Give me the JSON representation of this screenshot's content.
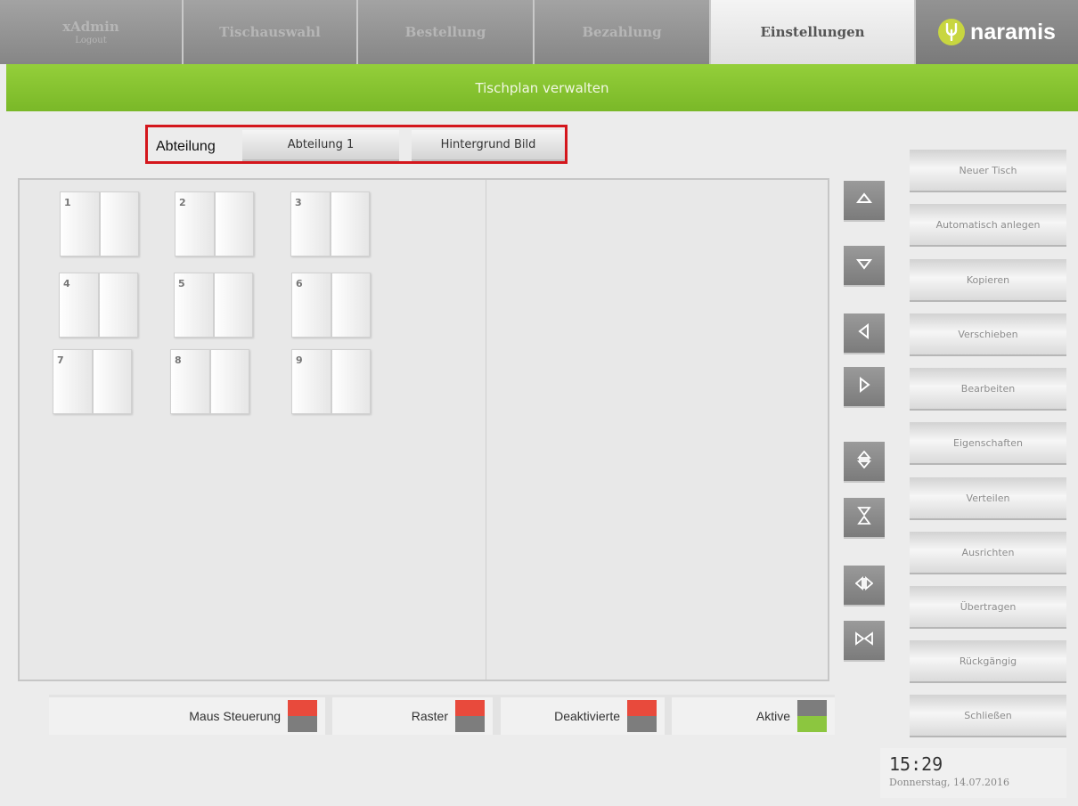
{
  "nav": {
    "tabs": [
      {
        "label": "xAdmin",
        "sub": "Logout"
      },
      {
        "label": "Tischauswahl"
      },
      {
        "label": "Bestellung"
      },
      {
        "label": "Bezahlung"
      },
      {
        "label": "Einstellungen",
        "active": true
      }
    ],
    "logo_text": "naramis"
  },
  "banner": {
    "title": "Tischplan verwalten"
  },
  "section": {
    "label": "Abteilung",
    "selected": "Abteilung 1",
    "background_button": "Hintergrund Bild"
  },
  "tables": [
    "1",
    "2",
    "3",
    "4",
    "5",
    "6",
    "7",
    "8",
    "9"
  ],
  "arrows": [
    {
      "icon": "triangle-up-icon"
    },
    {
      "icon": "triangle-down-icon"
    },
    {
      "icon": "triangle-left-icon"
    },
    {
      "icon": "triangle-right-icon"
    },
    {
      "icon": "expand-vertical-icon"
    },
    {
      "icon": "contract-vertical-icon"
    },
    {
      "icon": "expand-horizontal-icon"
    },
    {
      "icon": "contract-horizontal-icon"
    }
  ],
  "actions": [
    "Neuer Tisch",
    "Automatisch anlegen",
    "Kopieren",
    "Verschieben",
    "Bearbeiten",
    "Eigenschaften",
    "Verteilen",
    "Ausrichten",
    "Übertragen",
    "Rückgängig",
    "Schließen"
  ],
  "legend": [
    {
      "label": "Maus Steuerung",
      "top_color": "#e84a3c",
      "bottom_color": "#7d7d7d"
    },
    {
      "label": "Raster",
      "top_color": "#e84a3c",
      "bottom_color": "#7d7d7d"
    },
    {
      "label": "Deaktivierte",
      "top_color": "#e84a3c",
      "bottom_color": "#7d7d7d"
    },
    {
      "label": "Aktive",
      "top_color": "#7d7d7d",
      "bottom_color": "#8cc63f"
    }
  ],
  "clock": {
    "time": "15:29",
    "date": "Donnerstag, 14.07.2016"
  }
}
